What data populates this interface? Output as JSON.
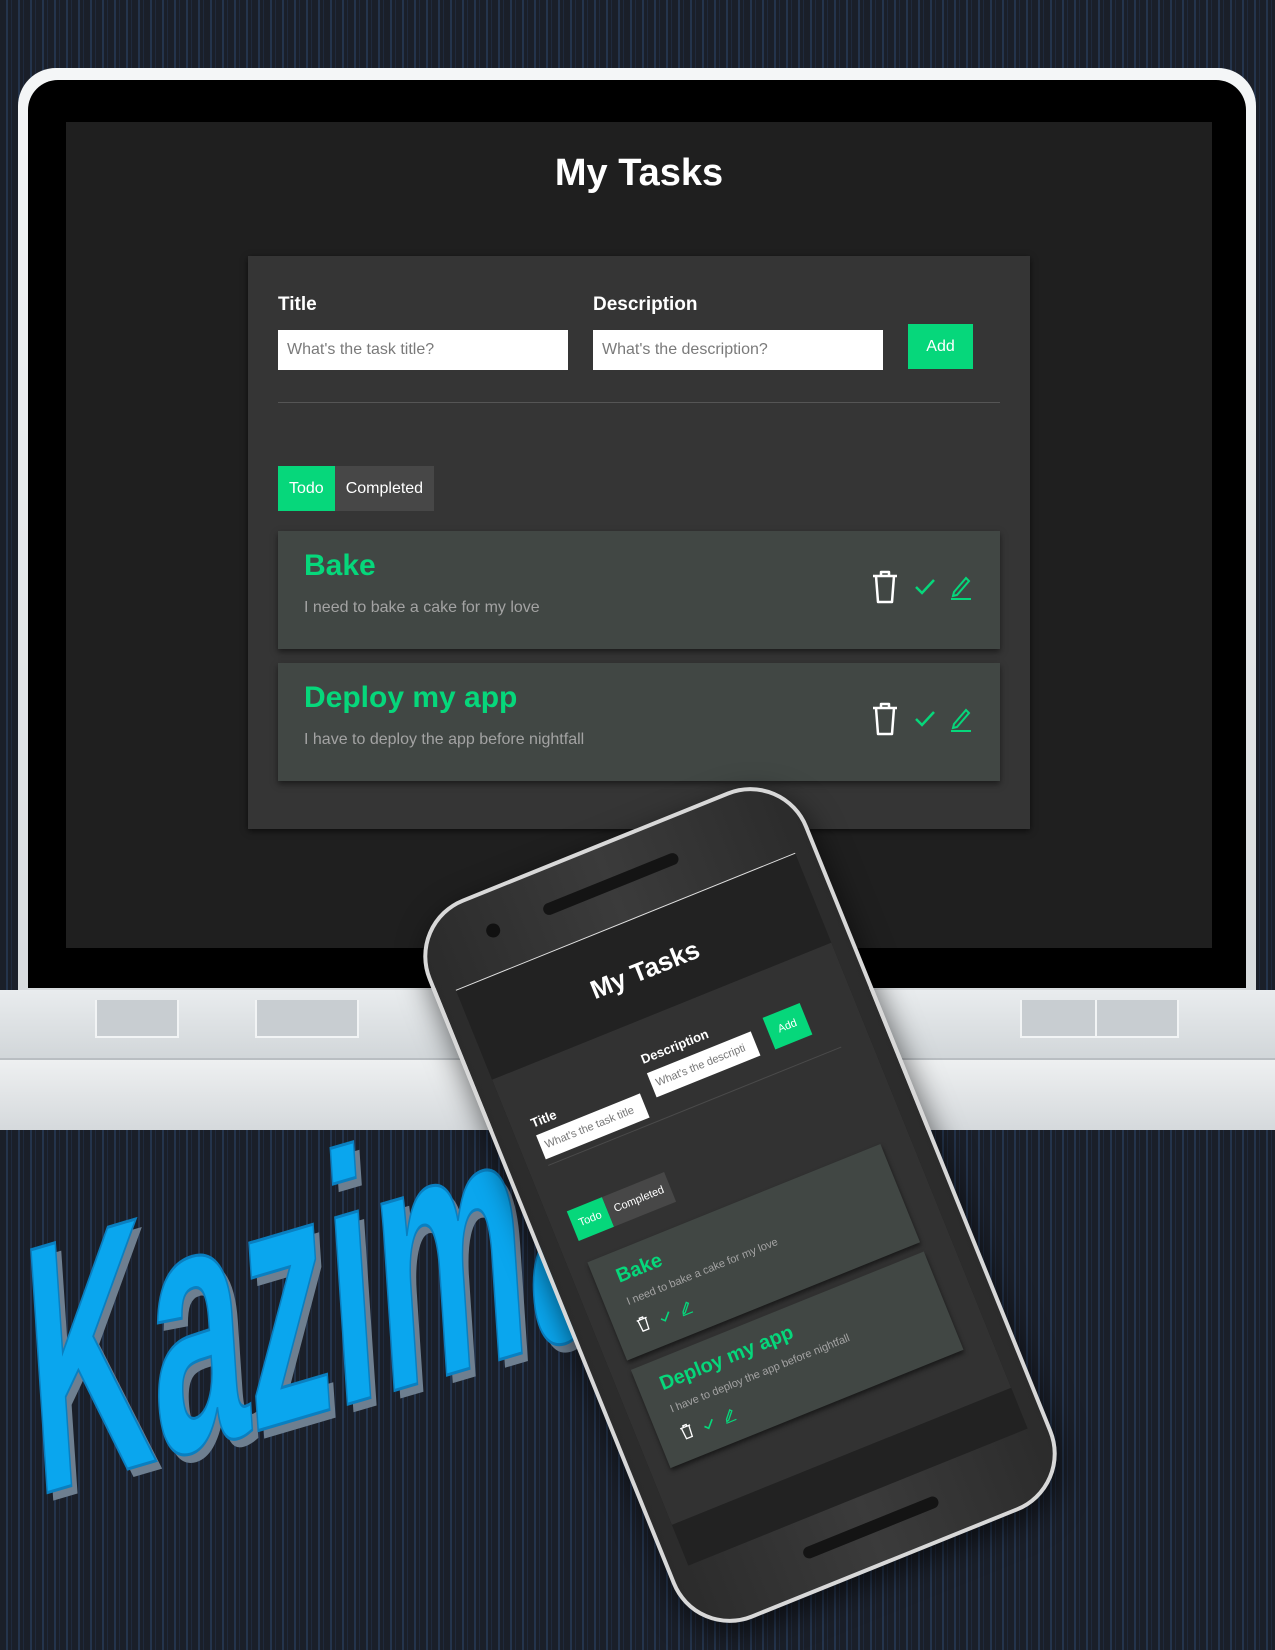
{
  "app": {
    "title": "My Tasks"
  },
  "form": {
    "title_label": "Title",
    "title_placeholder": "What's the task title?",
    "description_label": "Description",
    "description_placeholder": "What's the description?",
    "add_label": "Add"
  },
  "tabs": [
    {
      "label": "Todo",
      "active": true
    },
    {
      "label": "Completed",
      "active": false
    }
  ],
  "tasks": [
    {
      "title": "Bake",
      "description": "I need to bake a cake for my love"
    },
    {
      "title": "Deploy my app",
      "description": "I have to deploy the app before nightfall"
    }
  ],
  "icons": {
    "delete": "trash-icon",
    "complete": "check-icon",
    "edit": "pencil-icon"
  },
  "phone": {
    "title": "My Tasks",
    "title_label": "Title",
    "title_placeholder": "What's the task title",
    "description_label": "Description",
    "description_placeholder": "What's the descripti",
    "add_label": "Add",
    "tabs": [
      "Todo",
      "Completed"
    ],
    "tasks": [
      {
        "title": "Bake",
        "description": "I need to bake a cake for my love"
      },
      {
        "title": "Deploy my app",
        "description": "I have to deploy the app before nightfall"
      }
    ]
  },
  "brand": {
    "wordmark": "Kazimate"
  },
  "colors": {
    "accent": "#06d77b",
    "brand_blue": "#0aa6ee",
    "screen_bg": "#1f1f1f",
    "card_bg": "#353535",
    "task_bg": "#414744"
  }
}
